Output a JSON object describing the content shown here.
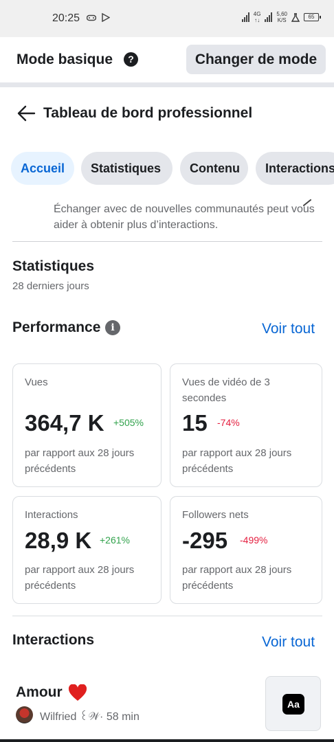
{
  "status_bar": {
    "time": "20:25",
    "network_4g": "4G",
    "speed_value": "5,60",
    "speed_unit": "K/S",
    "battery": "65"
  },
  "mode_bar": {
    "title": "Mode basique",
    "help_icon": "question-circle-icon",
    "switch_button": "Changer de mode"
  },
  "header": {
    "back_icon": "arrow-left-icon",
    "title": "Tableau de bord professionnel"
  },
  "tabs": [
    {
      "label": "Accueil",
      "active": true
    },
    {
      "label": "Statistiques",
      "active": false
    },
    {
      "label": "Contenu",
      "active": false
    },
    {
      "label": "Interactions",
      "active": false
    }
  ],
  "tip": {
    "text": "Échanger avec de nouvelles communautés peut vous aider à obtenir plus d’interactions.",
    "edit_icon": "pencil-icon"
  },
  "statistics": {
    "title": "Statistiques",
    "period": "28 derniers jours"
  },
  "performance": {
    "title": "Performance",
    "info_icon": "info-circle-icon",
    "see_all": "Voir tout",
    "cards": [
      {
        "label": "Vues",
        "value": "364,7 K",
        "delta": "+505%",
        "trend": "up",
        "note": "par rapport aux 28 jours précédents"
      },
      {
        "label": "Vues de vidéo de 3 secondes",
        "value": "15",
        "delta": "-74%",
        "trend": "down",
        "note": "par rapport aux 28 jours précédents"
      },
      {
        "label": "Interactions",
        "value": "28,9 K",
        "delta": "+261%",
        "trend": "up",
        "note": "par rapport aux 28 jours précédents"
      },
      {
        "label": "Followers nets",
        "value": "-295",
        "delta": "-499%",
        "trend": "down",
        "note": "par rapport aux 28 jours précédents"
      }
    ]
  },
  "interactions": {
    "title": "Interactions",
    "see_all": "Voir tout",
    "post": {
      "title": "Amour",
      "emoji_icon": "red-heart-icon",
      "author": "Wilfried ꒰𝒲·",
      "time": "58 min",
      "thumbnail_icon": "text-post-aa-icon",
      "thumbnail_text": "Aa"
    }
  },
  "colors": {
    "accent": "#0866d4",
    "positive": "#31a24c",
    "negative": "#e41e3f",
    "muted_text": "#65676b"
  }
}
